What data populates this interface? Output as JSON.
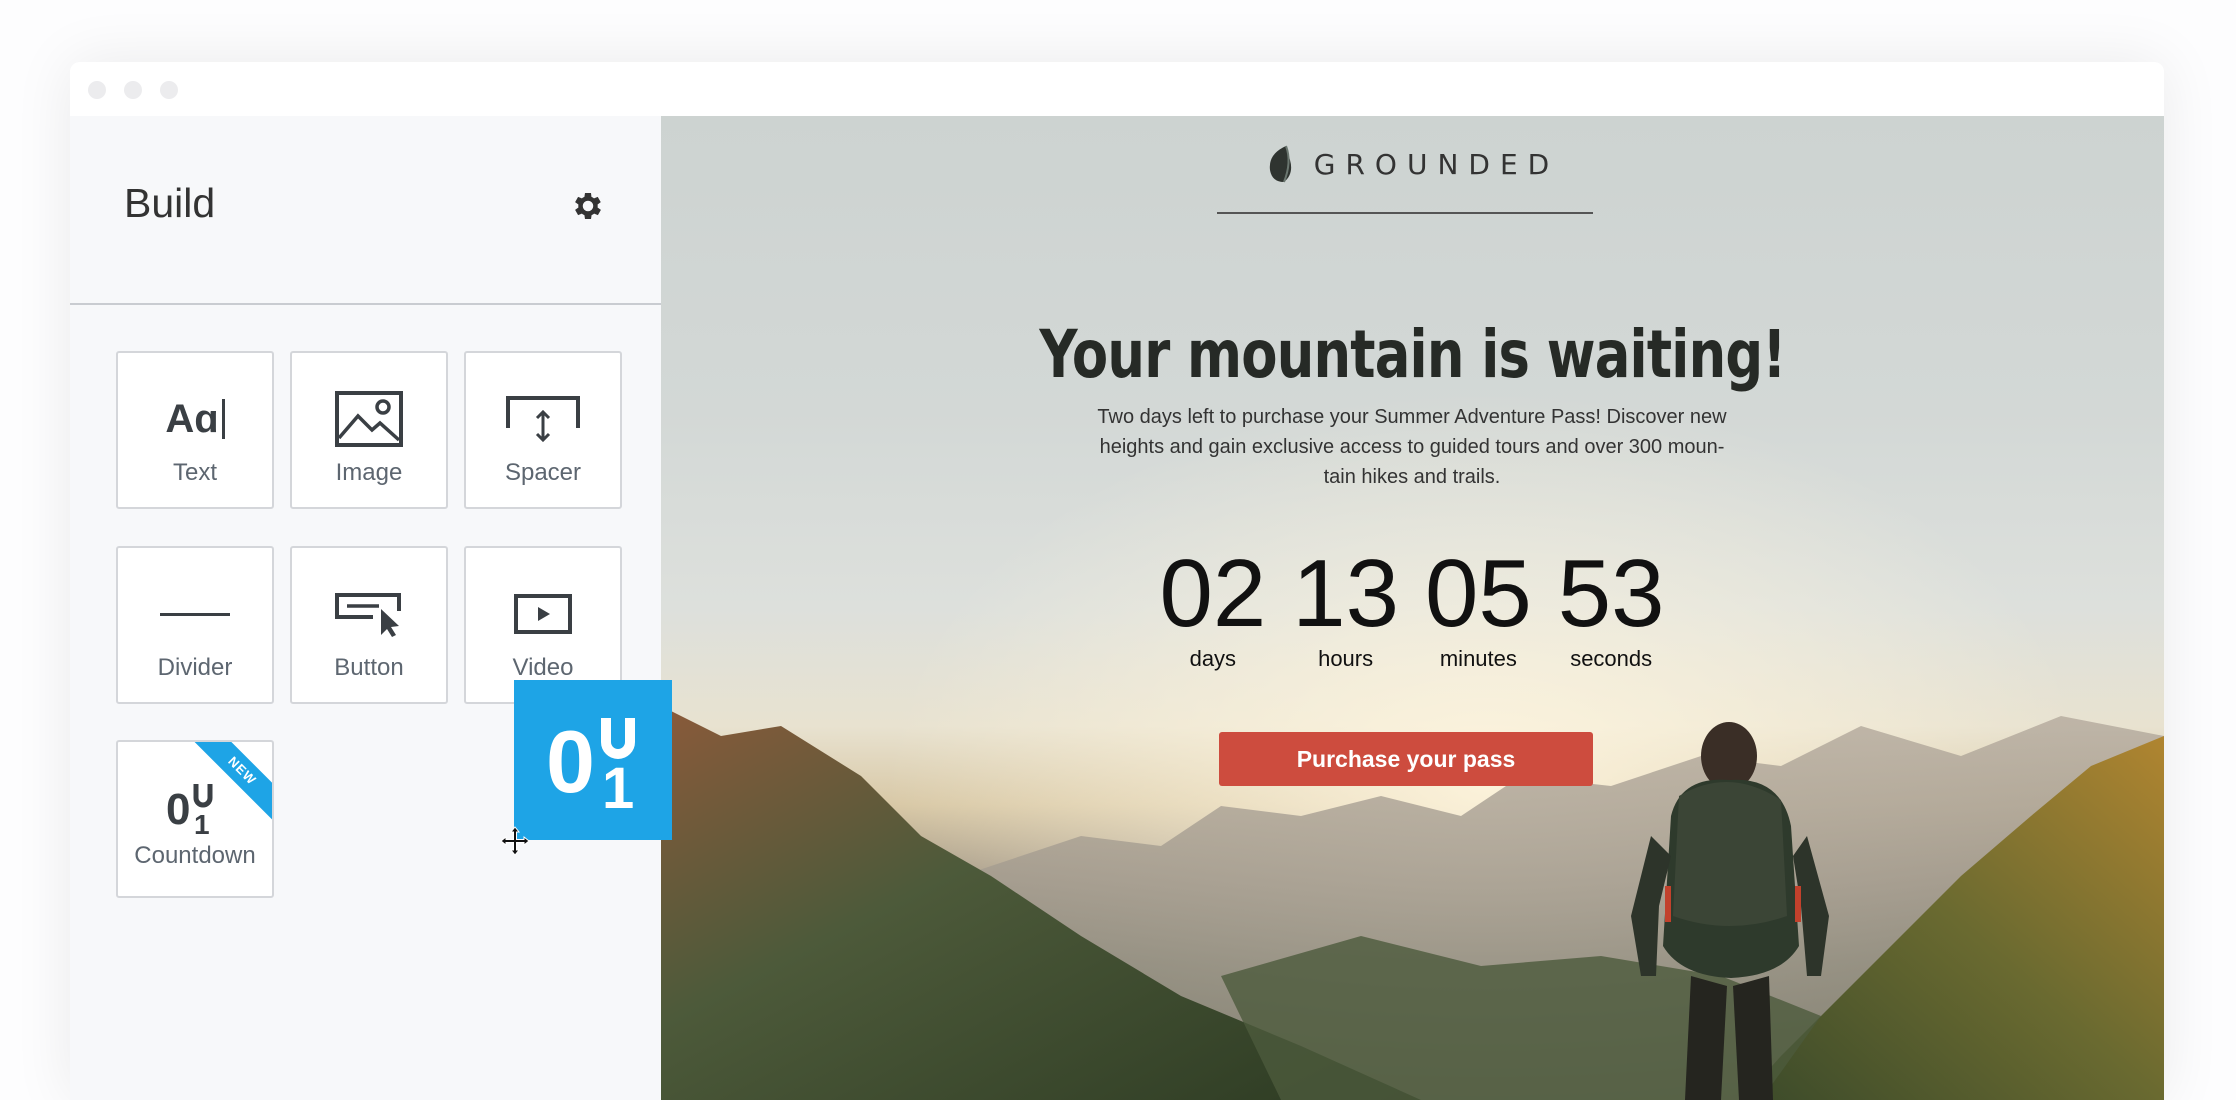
{
  "window": {
    "controls": [
      "close",
      "minimize",
      "maximize"
    ]
  },
  "sidebar": {
    "title": "Build",
    "settings_icon": "gear-icon",
    "blocks": [
      {
        "label": "Text",
        "icon": "text-icon"
      },
      {
        "label": "Image",
        "icon": "image-icon"
      },
      {
        "label": "Spacer",
        "icon": "spacer-icon"
      },
      {
        "label": "Divider",
        "icon": "divider-icon"
      },
      {
        "label": "Button",
        "icon": "button-icon"
      },
      {
        "label": "Video",
        "icon": "video-icon"
      },
      {
        "label": "Countdown",
        "icon": "countdown-icon",
        "badge": "NEW"
      }
    ],
    "text_icon_glyph": "Aɑ",
    "drag_ghost_icon": "countdown-icon"
  },
  "preview": {
    "brand": "GROUNDED",
    "headline": "Your mountain is waiting!",
    "body": "Two days left to purchase your Summer Adventure Pass! Discover new heights and gain exclusive access to guided tours and over 300 moun-tain hikes and trails.",
    "countdown": [
      {
        "value": "02",
        "label": "days"
      },
      {
        "value": "13",
        "label": "hours"
      },
      {
        "value": "05",
        "label": "minutes"
      },
      {
        "value": "53",
        "label": "seconds"
      }
    ],
    "cta_label": "Purchase your pass"
  },
  "colors": {
    "accent_blue": "#1ea4e6",
    "cta_red": "#cd4c3e"
  }
}
